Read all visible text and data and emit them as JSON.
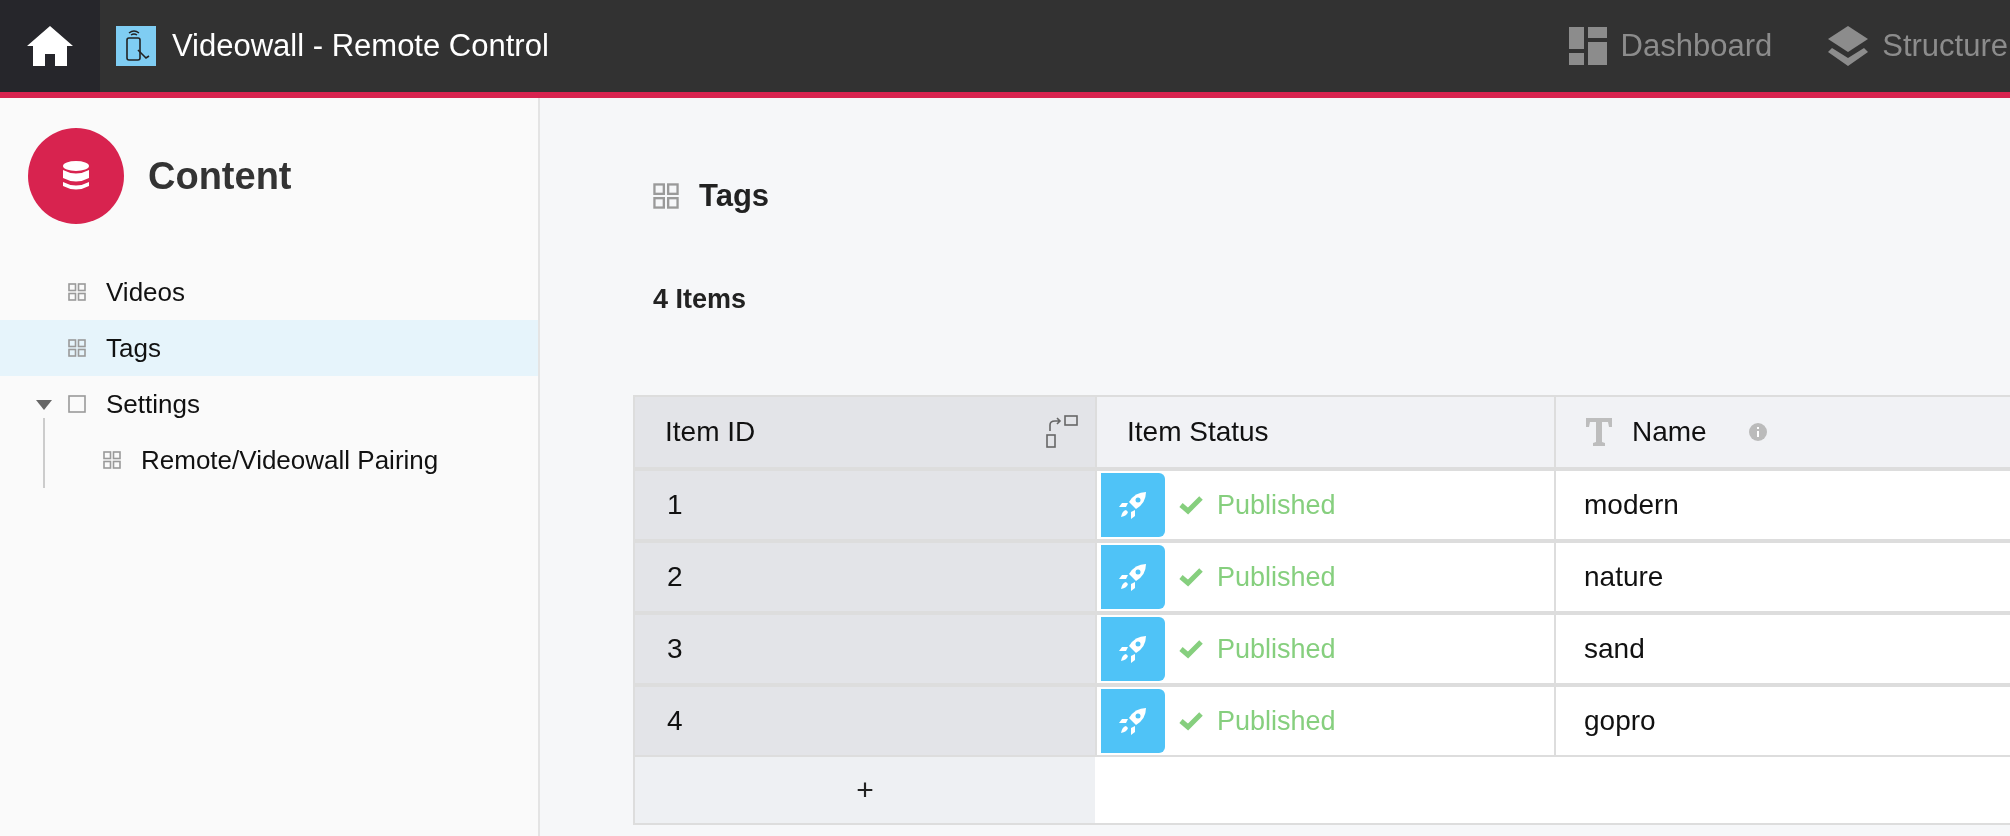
{
  "topbar": {
    "title": "Videowall - Remote Control",
    "nav": [
      {
        "label": "Dashboard",
        "kind": "dashboard"
      },
      {
        "label": "Structure",
        "kind": "layers"
      }
    ]
  },
  "sidebar": {
    "title": "Content",
    "items": [
      {
        "label": "Videos",
        "kind": "grid",
        "selected": false
      },
      {
        "label": "Tags",
        "kind": "grid",
        "selected": true
      },
      {
        "label": "Settings",
        "kind": "folder",
        "selected": false,
        "expanded": true,
        "children": [
          {
            "label": "Remote/Videowall Pairing",
            "kind": "grid",
            "selected": false
          }
        ]
      }
    ]
  },
  "main": {
    "title": "Tags",
    "count": "4 Items",
    "table": {
      "columns": [
        {
          "label": "Item ID",
          "kind": "id"
        },
        {
          "label": "Item Status",
          "kind": "status"
        },
        {
          "label": "Name",
          "kind": "text"
        }
      ],
      "rows": [
        {
          "id": "1",
          "status": "Published",
          "name": "modern"
        },
        {
          "id": "2",
          "status": "Published",
          "name": "nature"
        },
        {
          "id": "3",
          "status": "Published",
          "name": "sand"
        },
        {
          "id": "4",
          "status": "Published",
          "name": "gopro"
        }
      ],
      "add_button": "+"
    }
  }
}
